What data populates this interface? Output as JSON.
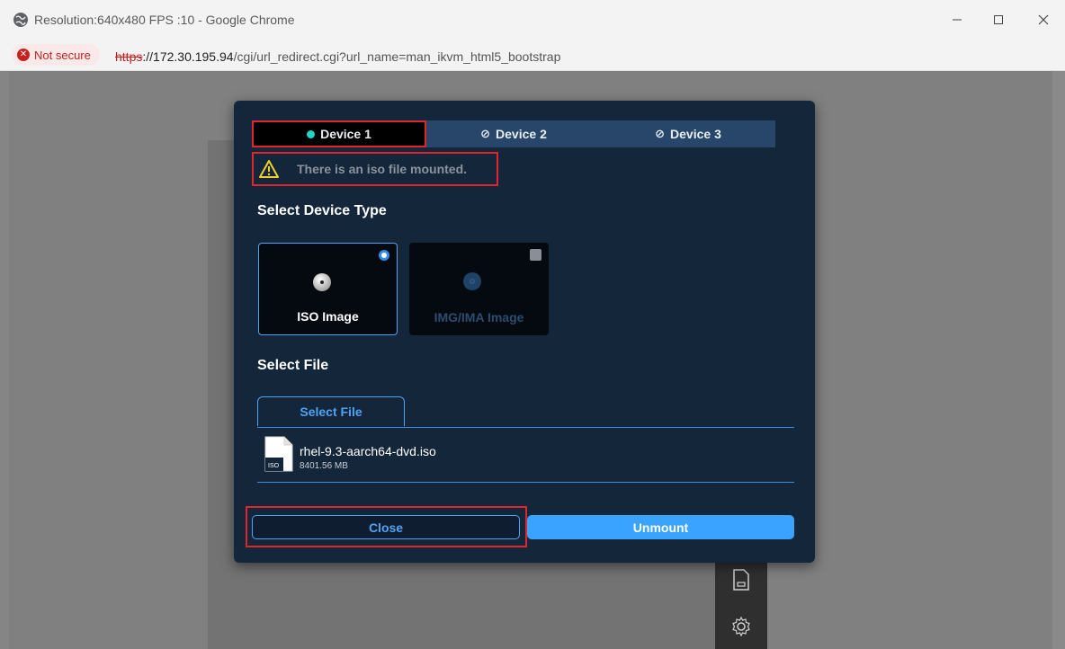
{
  "browser": {
    "window_title": "Resolution:640x480 FPS :10 - Google Chrome",
    "security_label": "Not secure",
    "url_scheme": "https",
    "url_host": "://172.30.195.94",
    "url_path": "/cgi/url_redirect.cgi?url_name=man_ikvm_html5_bootstrap"
  },
  "modal": {
    "tabs": [
      {
        "label": "Device 1",
        "status": "active"
      },
      {
        "label": "Device 2",
        "status": "disabled"
      },
      {
        "label": "Device 3",
        "status": "disabled"
      }
    ],
    "warning": "There is an iso file mounted.",
    "device_type_title": "Select Device Type",
    "device_types": [
      {
        "label": "ISO Image",
        "selected": true
      },
      {
        "label": "IMG/IMA Image",
        "selected": false
      }
    ],
    "select_file_title": "Select File",
    "select_file_button": "Select File",
    "file": {
      "name": "rhel-9.3-aarch64-dvd.iso",
      "size": "8401.56 MB",
      "icon_label": "ISO"
    },
    "close_label": "Close",
    "unmount_label": "Unmount"
  },
  "colors": {
    "modal_bg": "#14263a",
    "accent": "#3aa3ff",
    "highlight": "#e0252b",
    "active_dot": "#1ed6c7"
  },
  "icons": [
    "globe-icon",
    "minimize-icon",
    "maximize-icon",
    "close-window-icon",
    "not-secure-icon",
    "warning-icon",
    "disc-icon",
    "file-icon",
    "document-tool-icon",
    "settings-gear-icon"
  ]
}
